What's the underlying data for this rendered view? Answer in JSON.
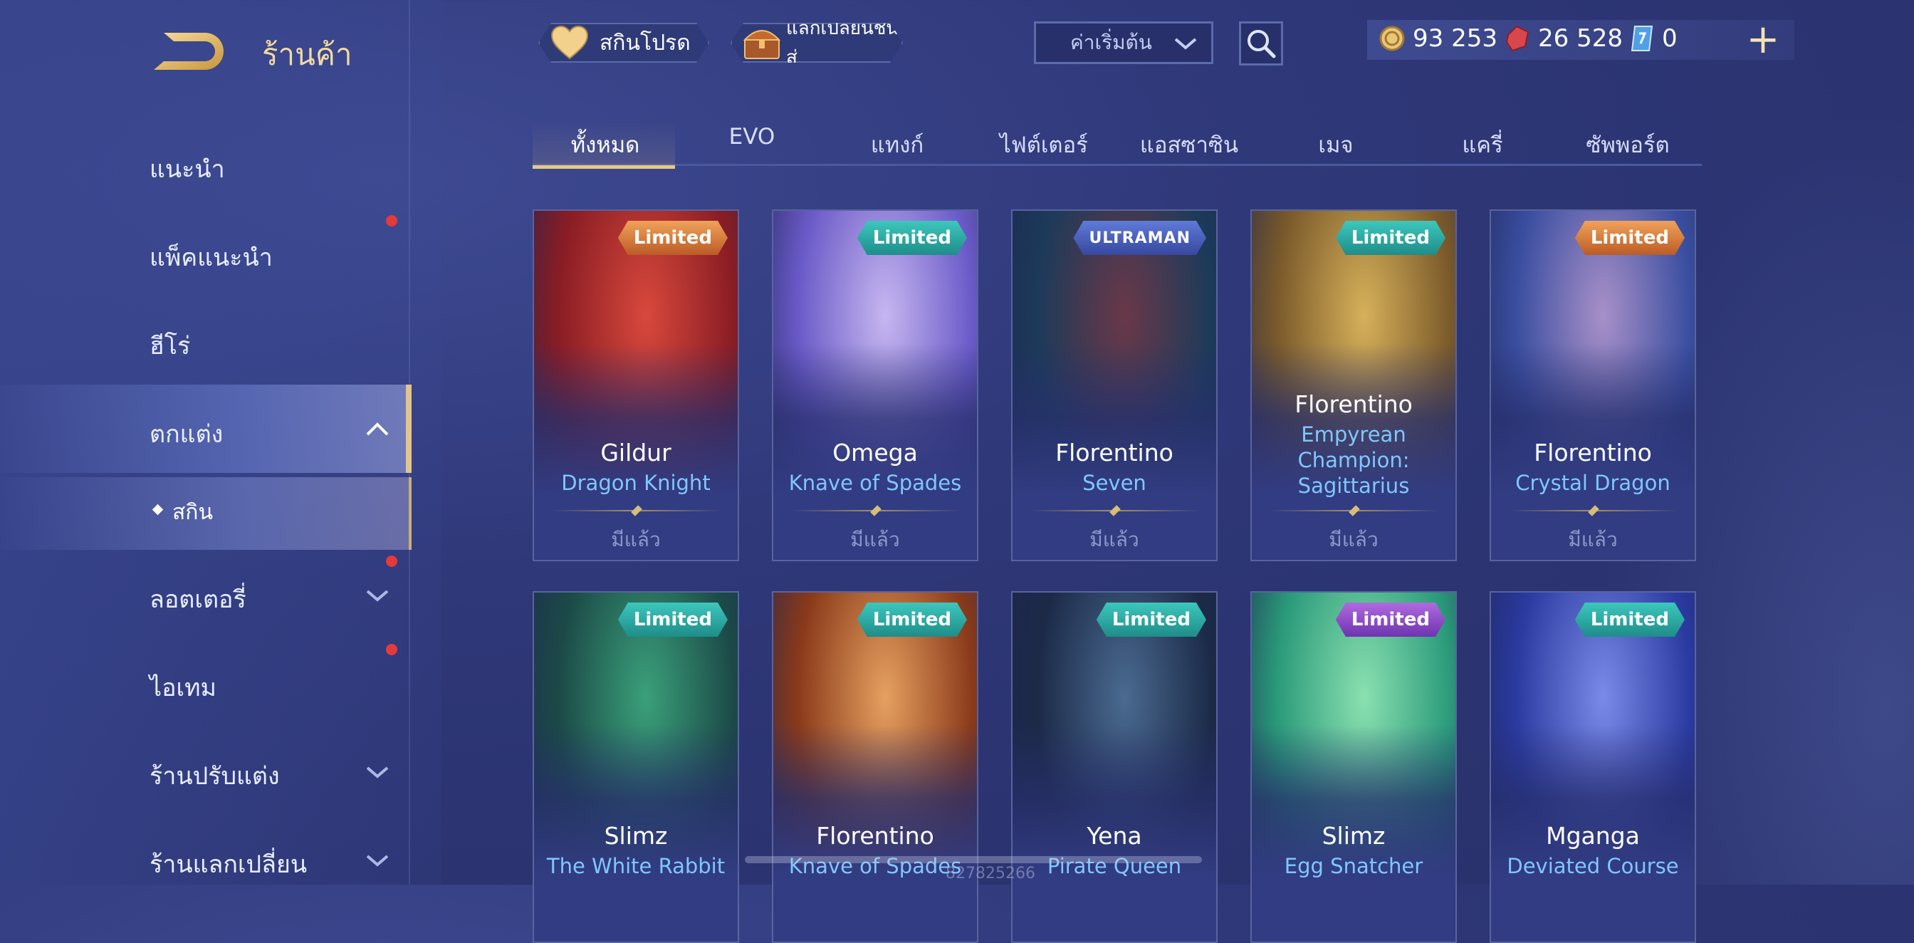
{
  "header": {
    "title": "ร้านค้า",
    "wishlist_label": "สกินโปรด",
    "exchange_label": "แลกเปลี่ยนชิ้นส่",
    "sort_value": "ค่าเริ่มต้น"
  },
  "currency": {
    "gold": "93 253",
    "ruby": "26 528",
    "voucher": "0"
  },
  "sidebar": {
    "items": [
      {
        "label": "แนะนำ"
      },
      {
        "label": "แพ็คแนะนำ"
      },
      {
        "label": "ฮีโร่"
      },
      {
        "label": "ตกแต่ง"
      },
      {
        "label": "สกิน"
      },
      {
        "label": "ลอตเตอรี่"
      },
      {
        "label": "ไอเทม"
      },
      {
        "label": "ร้านปรับแต่ง"
      },
      {
        "label": "ร้านแลกเปลี่ยน"
      }
    ]
  },
  "tabs": [
    {
      "label": "ทั้งหมด"
    },
    {
      "label": "EVO"
    },
    {
      "label": "แทงก์"
    },
    {
      "label": "ไฟต์เตอร์"
    },
    {
      "label": "แอสซาซิน"
    },
    {
      "label": "เมจ"
    },
    {
      "label": "แครี่"
    },
    {
      "label": "ซัพพอร์ต"
    }
  ],
  "cards": [
    {
      "badge": "Limited",
      "hero": "Gildur",
      "skin": "Dragon Knight",
      "status": "มีแล้ว",
      "colors": [
        "#8a1d24",
        "#d8483c"
      ]
    },
    {
      "badge": "Limited",
      "hero": "Omega",
      "skin": "Knave of Spades",
      "status": "มีแล้ว",
      "colors": [
        "#6a5ac8",
        "#c6b6f0"
      ]
    },
    {
      "badge": "ULTRAMAN",
      "hero": "Florentino",
      "skin": "Seven",
      "status": "มีแล้ว",
      "colors": [
        "#1c3a5a",
        "#6a3848"
      ]
    },
    {
      "badge": "Limited",
      "hero": "Florentino",
      "skin": "Empyrean Champion: Sagittarius",
      "status": "มีแล้ว",
      "colors": [
        "#7a5a2a",
        "#d6b05a"
      ]
    },
    {
      "badge": "Limited",
      "hero": "Florentino",
      "skin": "Crystal Dragon",
      "status": "มีแล้ว",
      "colors": [
        "#3a4ea0",
        "#a890c8"
      ]
    },
    {
      "badge": "Limited",
      "hero": "Slimz",
      "skin": "The White Rabbit",
      "status": "",
      "colors": [
        "#1c4a48",
        "#3aa07a"
      ]
    },
    {
      "badge": "Limited",
      "hero": "Florentino",
      "skin": "Knave of Spades",
      "status": "",
      "colors": [
        "#8a3a1a",
        "#e6a060"
      ]
    },
    {
      "badge": "Limited",
      "hero": "Yena",
      "skin": "Pirate Queen",
      "status": "",
      "colors": [
        "#1c2a48",
        "#4a6a90"
      ]
    },
    {
      "badge": "Limited",
      "hero": "Slimz",
      "skin": "Egg Snatcher",
      "status": "",
      "colors": [
        "#2a9a7a",
        "#8ae0b0"
      ]
    },
    {
      "badge": "Limited",
      "hero": "Mganga",
      "skin": "Deviated Course",
      "status": "",
      "colors": [
        "#2a3aa0",
        "#7a8ae8"
      ]
    }
  ],
  "footer": {
    "watermark": "827825266"
  }
}
